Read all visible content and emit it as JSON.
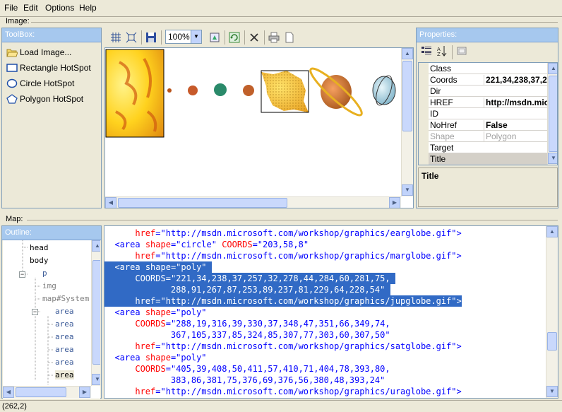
{
  "menu": [
    "File",
    "Edit",
    "Options",
    "Help"
  ],
  "image_section_label": "Image:",
  "map_section_label": "Map:",
  "toolbox": {
    "title": "ToolBox:",
    "items": [
      {
        "label": "Load Image...",
        "icon": "folder-open-icon"
      },
      {
        "label": "Rectangle HotSpot",
        "icon": "rectangle-icon"
      },
      {
        "label": "Circle HotSpot",
        "icon": "circle-icon"
      },
      {
        "label": "Polygon HotSpot",
        "icon": "polygon-icon"
      }
    ]
  },
  "image_toolbar": {
    "buttons": [
      "grid-icon",
      "fit-icon",
      "save-icon",
      "refresh-icon",
      "delete-icon",
      "print-icon",
      "new-document-icon"
    ],
    "zoom": "100%"
  },
  "properties": {
    "title": "Properties:",
    "rows": [
      {
        "name": "Class",
        "value": "",
        "disabled": false
      },
      {
        "name": "Coords",
        "value": "221,34,238,37,2",
        "disabled": false
      },
      {
        "name": "Dir",
        "value": "",
        "disabled": false
      },
      {
        "name": "HREF",
        "value": "http://msdn.mic",
        "disabled": false
      },
      {
        "name": "ID",
        "value": "",
        "disabled": false
      },
      {
        "name": "NoHref",
        "value": "False",
        "disabled": false
      },
      {
        "name": "Shape",
        "value": "Polygon",
        "disabled": true
      },
      {
        "name": "Target",
        "value": "",
        "disabled": false
      },
      {
        "name": "Title",
        "value": "",
        "disabled": false
      }
    ],
    "description_title": "Title"
  },
  "outline": {
    "title": "Outline:",
    "nodes": [
      {
        "text": "head",
        "style": "normal"
      },
      {
        "text": "body",
        "style": "normal"
      },
      {
        "text": "p",
        "style": "blue"
      },
      {
        "text": "img",
        "style": "gray"
      },
      {
        "text": "map#System",
        "style": "gray"
      },
      {
        "text": "area",
        "style": "blue"
      },
      {
        "text": "area",
        "style": "blue"
      },
      {
        "text": "area",
        "style": "blue"
      },
      {
        "text": "area",
        "style": "blue"
      },
      {
        "text": "area",
        "style": "blue"
      },
      {
        "text": "area",
        "style": "sel"
      }
    ]
  },
  "code_lines": [
    {
      "hl": false,
      "tokens": [
        [
          "pad",
          "      "
        ],
        [
          "attr",
          "href"
        ],
        [
          "eq",
          "="
        ],
        [
          "val",
          "\"http://msdn.microsoft.com/workshop/graphics/earglobe.gif\""
        ],
        [
          "tag",
          ">"
        ]
      ]
    },
    {
      "hl": false,
      "tokens": [
        [
          "pad",
          "  "
        ],
        [
          "tag",
          "<area"
        ],
        [
          "pad",
          " "
        ],
        [
          "attr",
          "shape"
        ],
        [
          "eq",
          "="
        ],
        [
          "val",
          "\"circle\""
        ],
        [
          "pad",
          " "
        ],
        [
          "attr",
          "COORDS"
        ],
        [
          "eq",
          "="
        ],
        [
          "val",
          "\"203,58,8\""
        ]
      ]
    },
    {
      "hl": false,
      "tokens": [
        [
          "pad",
          "      "
        ],
        [
          "attr",
          "href"
        ],
        [
          "eq",
          "="
        ],
        [
          "val",
          "\"http://msdn.microsoft.com/workshop/graphics/marglobe.gif\""
        ],
        [
          "tag",
          ">"
        ]
      ]
    },
    {
      "hl": true,
      "tokens": [
        [
          "pad",
          "  "
        ],
        [
          "tag",
          "<area"
        ],
        [
          "pad",
          " "
        ],
        [
          "attr",
          "shape"
        ],
        [
          "eq",
          "="
        ],
        [
          "val",
          "\"poly\""
        ],
        [
          "pad",
          " "
        ]
      ]
    },
    {
      "hl": true,
      "tokens": [
        [
          "pad",
          "      "
        ],
        [
          "attr",
          "COORDS"
        ],
        [
          "eq",
          "="
        ],
        [
          "val",
          "\"221,34,238,37,257,32,278,44,284,60,281,75,"
        ],
        [
          "pad",
          " "
        ]
      ]
    },
    {
      "hl": true,
      "tokens": [
        [
          "pad",
          "             "
        ],
        [
          "val",
          "288,91,267,87,253,89,237,81,229,64,228,54\""
        ],
        [
          "pad",
          " "
        ]
      ]
    },
    {
      "hl": true,
      "tokens": [
        [
          "pad",
          "      "
        ],
        [
          "attr",
          "href"
        ],
        [
          "eq",
          "="
        ],
        [
          "val",
          "\"http://msdn.microsoft.com/workshop/graphics/jupglobe.gif\""
        ],
        [
          "tag",
          ">"
        ]
      ]
    },
    {
      "hl": false,
      "tokens": [
        [
          "pad",
          "  "
        ],
        [
          "tag",
          "<area"
        ],
        [
          "pad",
          " "
        ],
        [
          "attr",
          "shape"
        ],
        [
          "eq",
          "="
        ],
        [
          "val",
          "\"poly\""
        ]
      ]
    },
    {
      "hl": false,
      "tokens": [
        [
          "pad",
          "      "
        ],
        [
          "attr",
          "COORDS"
        ],
        [
          "eq",
          "="
        ],
        [
          "val",
          "\"288,19,316,39,330,37,348,47,351,66,349,74,"
        ]
      ]
    },
    {
      "hl": false,
      "tokens": [
        [
          "pad",
          "             "
        ],
        [
          "val",
          "367,105,337,85,324,85,307,77,303,60,307,50\""
        ]
      ]
    },
    {
      "hl": false,
      "tokens": [
        [
          "pad",
          "      "
        ],
        [
          "attr",
          "href"
        ],
        [
          "eq",
          "="
        ],
        [
          "val",
          "\"http://msdn.microsoft.com/workshop/graphics/satglobe.gif\""
        ],
        [
          "tag",
          ">"
        ]
      ]
    },
    {
      "hl": false,
      "tokens": [
        [
          "pad",
          "  "
        ],
        [
          "tag",
          "<area"
        ],
        [
          "pad",
          " "
        ],
        [
          "attr",
          "shape"
        ],
        [
          "eq",
          "="
        ],
        [
          "val",
          "\"poly\""
        ]
      ]
    },
    {
      "hl": false,
      "tokens": [
        [
          "pad",
          "      "
        ],
        [
          "attr",
          "COORDS"
        ],
        [
          "eq",
          "="
        ],
        [
          "val",
          "\"405,39,408,50,411,57,410,71,404,78,393,80,"
        ]
      ]
    },
    {
      "hl": false,
      "tokens": [
        [
          "pad",
          "             "
        ],
        [
          "val",
          "383,86,381,75,376,69,376,56,380,48,393,24\""
        ]
      ]
    },
    {
      "hl": false,
      "tokens": [
        [
          "pad",
          "      "
        ],
        [
          "attr",
          "href"
        ],
        [
          "eq",
          "="
        ],
        [
          "val",
          "\"http://msdn.microsoft.com/workshop/graphics/uraglobe.gif\""
        ],
        [
          "tag",
          ">"
        ]
      ]
    }
  ],
  "status_text": "(262,2)",
  "colors": {
    "panel_header": "#a6c8ee",
    "selection": "#316ac5",
    "tag": "#0000ff",
    "attribute": "#ff0000"
  }
}
